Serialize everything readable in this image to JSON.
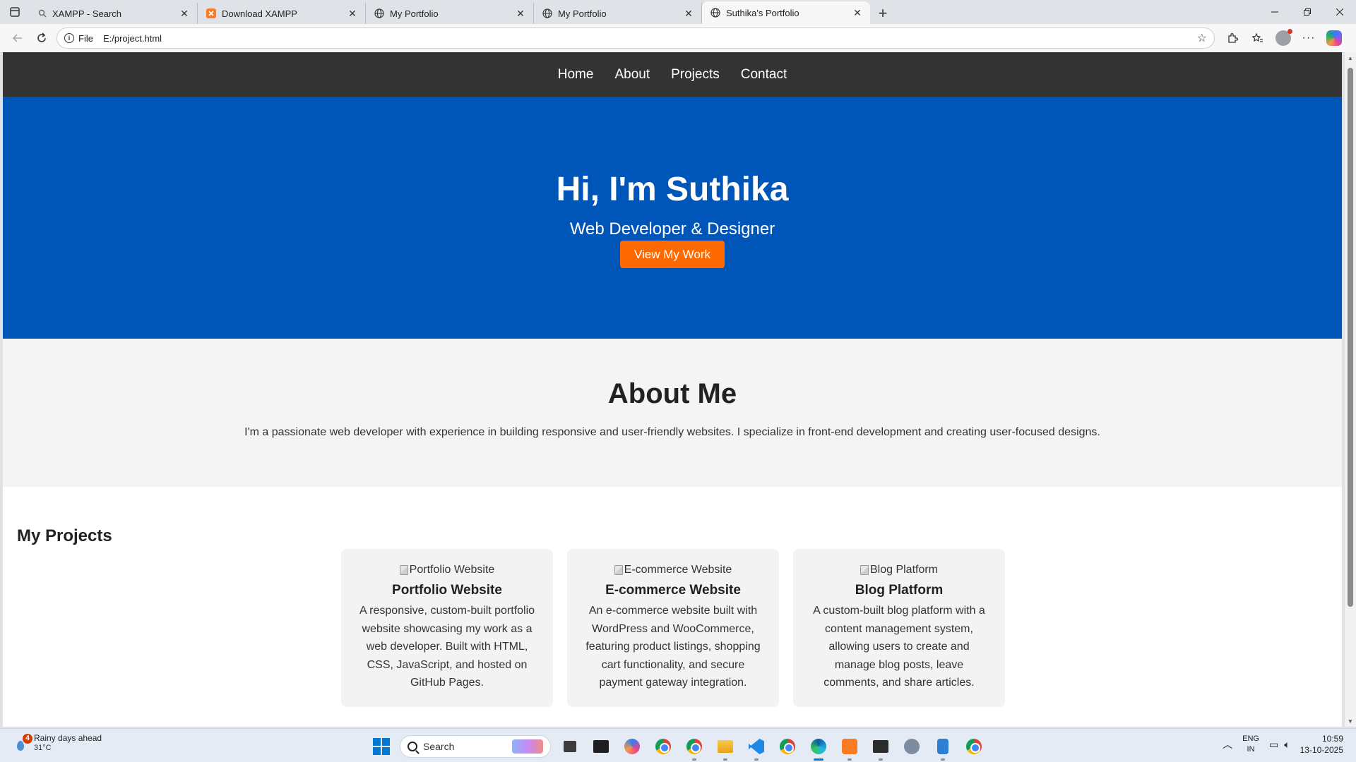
{
  "browser": {
    "tabs": [
      {
        "title": "XAMPP - Search",
        "icon": "search-icon"
      },
      {
        "title": "Download XAMPP",
        "icon": "xampp-icon"
      },
      {
        "title": "My Portfolio",
        "icon": "globe-icon"
      },
      {
        "title": "My Portfolio",
        "icon": "globe-icon"
      },
      {
        "title": "Suthika's Portfolio",
        "icon": "globe-icon",
        "active": true
      }
    ],
    "new_tab": "+",
    "address": {
      "scheme_label": "File",
      "url": "E:/project.html"
    }
  },
  "page": {
    "nav": [
      "Home",
      "About",
      "Projects",
      "Contact"
    ],
    "hero": {
      "title": "Hi, I'm Suthika",
      "subtitle": "Web Developer & Designer",
      "cta": "View My Work"
    },
    "about": {
      "heading": "About Me",
      "text": "I'm a passionate web developer with experience in building responsive and user-friendly websites. I specialize in front-end development and creating user-focused designs."
    },
    "projects": {
      "heading": "My Projects",
      "items": [
        {
          "image_alt": "Portfolio Website",
          "title": "Portfolio Website",
          "description": "A responsive, custom-built portfolio website showcasing my work as a web developer. Built with HTML, CSS, JavaScript, and hosted on GitHub Pages."
        },
        {
          "image_alt": "E-commerce Website",
          "title": "E-commerce Website",
          "description": "An e-commerce website built with WordPress and WooCommerce, featuring product listings, shopping cart functionality, and secure payment gateway integration."
        },
        {
          "image_alt": "Blog Platform",
          "title": "Blog Platform",
          "description": "A custom-built blog platform with a content management system, allowing users to create and manage blog posts, leave comments, and share articles."
        }
      ]
    }
  },
  "colors": {
    "nav_bg": "#333333",
    "hero_bg": "#0055b8",
    "cta_bg": "#ff6a00",
    "about_bg": "#f4f4f4",
    "card_bg": "#f3f3f3"
  },
  "taskbar": {
    "weather": {
      "badge": "4",
      "text": "Rainy days ahead",
      "temp": "31°C"
    },
    "search_placeholder": "Search",
    "tray": {
      "lang_top": "ENG",
      "lang_bottom": "IN",
      "time": "10:59",
      "date": "13-10-2025"
    }
  }
}
